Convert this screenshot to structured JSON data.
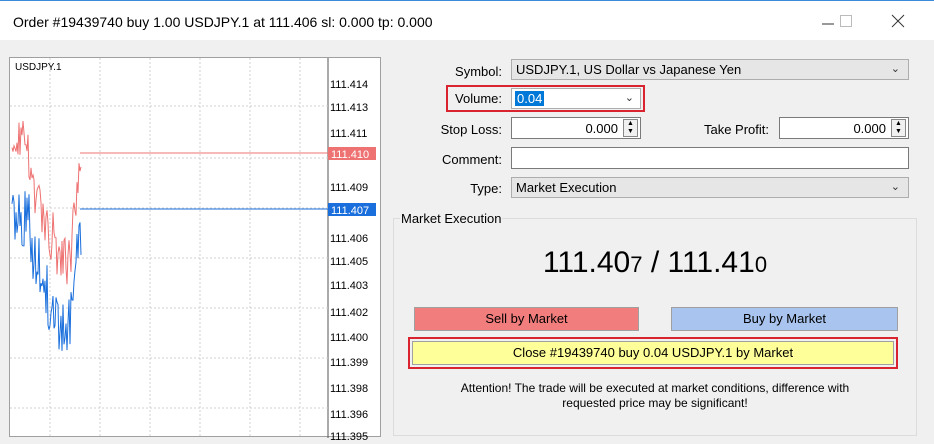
{
  "window": {
    "title": "Order #19439740 buy 1.00 USDJPY.1 at 111.406 sl: 0.000 tp: 0.000",
    "minimize_icon": "minimize-icon",
    "maximize_icon": "maximize-icon",
    "close_icon": "close-icon"
  },
  "chart": {
    "symbol": "USDJPY.1",
    "axis_labels": [
      "111.414",
      "111.413",
      "111.411",
      "111.410",
      "111.409",
      "111.407",
      "111.406",
      "111.405",
      "111.403",
      "111.402",
      "111.400",
      "111.399",
      "111.398",
      "111.396",
      "111.395"
    ],
    "ask_label": "111.410",
    "bid_label": "111.407",
    "ask_color": "#ee7272",
    "bid_color": "#1a6fdc"
  },
  "form": {
    "symbol_label": "Symbol:",
    "symbol_value": "USDJPY.1, US Dollar vs Japanese Yen",
    "volume_label": "Volume:",
    "volume_value": "0.04",
    "stoploss_label": "Stop Loss:",
    "stoploss_value": "0.000",
    "takeprofit_label": "Take Profit:",
    "takeprofit_value": "0.000",
    "comment_label": "Comment:",
    "comment_value": "",
    "type_label": "Type:",
    "type_value": "Market Execution"
  },
  "execution": {
    "group_title": "Market Execution",
    "bid_main": "111.40",
    "bid_small": "7",
    "separator": " / ",
    "ask_main": "111.41",
    "ask_small": "0",
    "sell_label": "Sell by Market",
    "buy_label": "Buy by Market",
    "close_label": "Close #19439740 buy 0.04 USDJPY.1 by Market",
    "attention_line1": "Attention! The trade will be executed at market conditions, difference with",
    "attention_line2": "requested price may be significant!",
    "sell_color": "#f27d7d",
    "buy_color": "#a8c4ef",
    "close_color": "#ffff99"
  }
}
